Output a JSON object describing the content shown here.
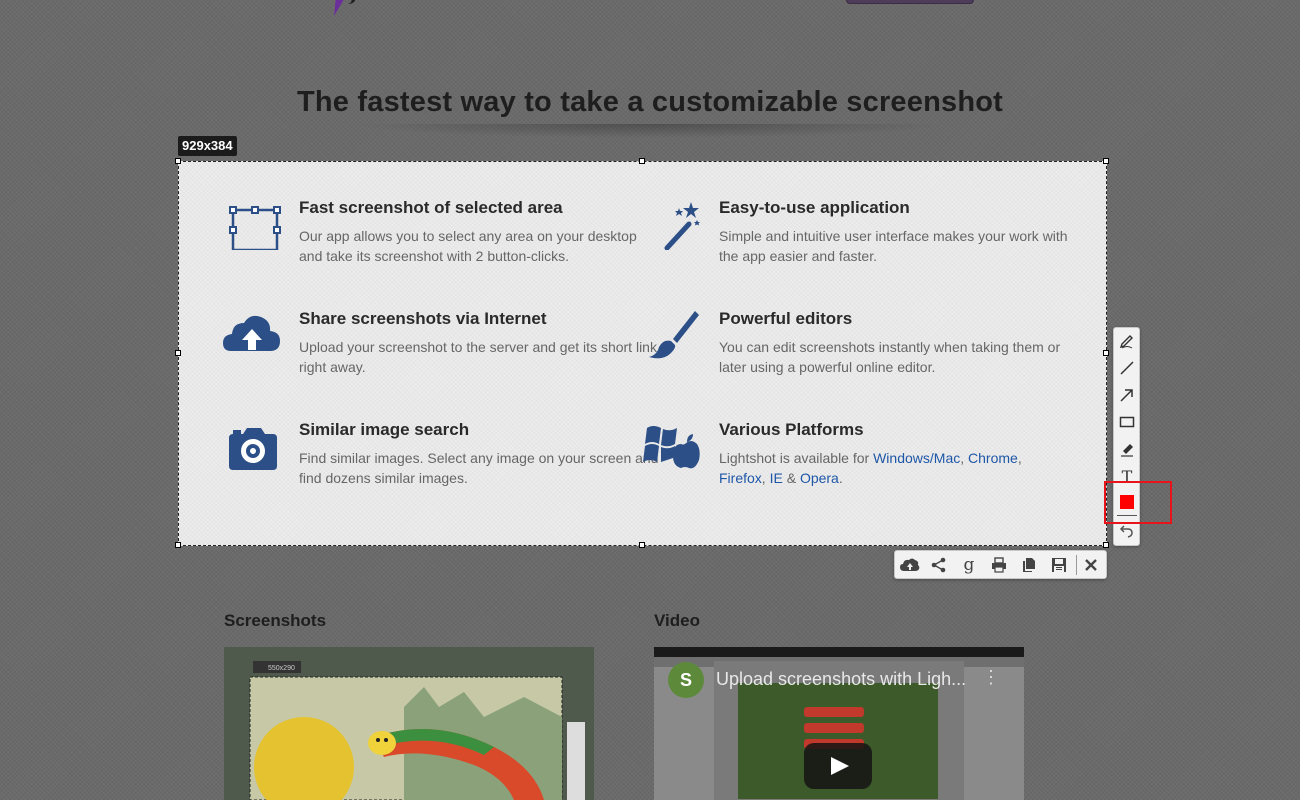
{
  "page": {
    "heading": "The fastest way to take a customizable screenshot"
  },
  "selection": {
    "size_label": "929x384"
  },
  "features": [
    {
      "title": "Fast screenshot of selected area",
      "text": "Our app allows you to select any area on your desktop and take its screenshot with 2 button-clicks.",
      "icon": "selection-area-icon"
    },
    {
      "title": "Easy-to-use application",
      "text": "Simple and intuitive user interface makes your work with the app easier and faster.",
      "icon": "magic-wand-icon"
    },
    {
      "title": "Share screenshots via Internet",
      "text": "Upload your screenshot to the server and get its short link right away.",
      "icon": "cloud-upload-icon"
    },
    {
      "title": "Powerful editors",
      "text": "You can edit screenshots instantly when taking them or later using a powerful online editor.",
      "icon": "paint-brush-icon"
    },
    {
      "title": "Similar image search",
      "text": "Find similar images. Select any image on your screen and find dozens similar images.",
      "icon": "camera-icon"
    },
    {
      "title": "Various Platforms",
      "text_prefix": "Lightshot is available for ",
      "link_windows_mac": "Windows/Mac",
      "sep1": ", ",
      "link_chrome": "Chrome",
      "sep2": ",",
      "link_firefox": "Firefox",
      "sep3": ", ",
      "link_ie": "IE",
      "sep4": " & ",
      "link_opera": "Opera",
      "text_suffix": ".",
      "icon": "windows-apple-icon"
    }
  ],
  "draw_toolbar": {
    "tools": [
      "pen-icon",
      "line-icon",
      "arrow-icon",
      "rectangle-icon",
      "marker-icon",
      "text-icon",
      "color-picker",
      "undo-icon"
    ],
    "current_color": "#ff0000",
    "text_tool_glyph": "T"
  },
  "action_toolbar": {
    "actions": [
      "upload-icon",
      "share-icon",
      "google-search-icon",
      "print-icon",
      "copy-icon",
      "save-icon",
      "close-icon"
    ]
  },
  "sections": {
    "screenshots_title": "Screenshots",
    "video_title": "Video",
    "video_avatar_letter": "S",
    "video_caption": "Upload screenshots with Ligh...",
    "thumb_size_label": "550x290"
  },
  "colors": {
    "highlight": "#e8141b",
    "link": "#1f57a8",
    "icon_blue": "#2b4f86"
  }
}
